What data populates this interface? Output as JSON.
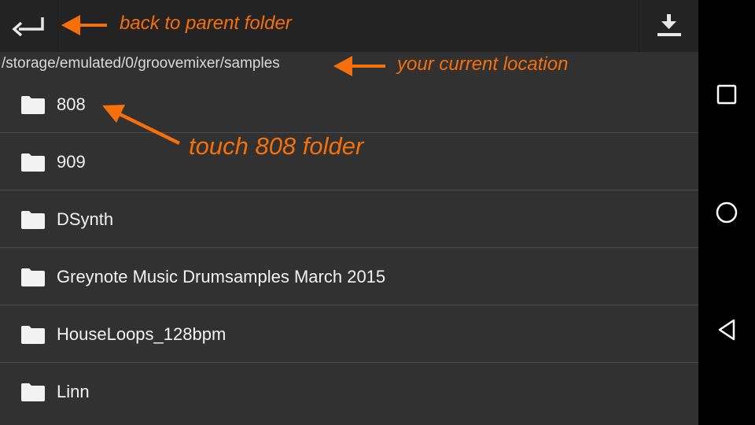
{
  "toolbar": {
    "back_icon": "return-arrow-icon",
    "download_icon": "download-icon"
  },
  "location": {
    "path": "/storage/emulated/0/groovemixer/samples"
  },
  "folders": [
    {
      "label": "808",
      "icon": "folder-icon"
    },
    {
      "label": "909",
      "icon": "folder-icon"
    },
    {
      "label": "DSynth",
      "icon": "folder-icon"
    },
    {
      "label": "Greynote Music Drumsamples March 2015",
      "icon": "folder-icon"
    },
    {
      "label": "HouseLoops_128bpm",
      "icon": "folder-icon"
    },
    {
      "label": "Linn",
      "icon": "folder-icon"
    }
  ],
  "annotations": {
    "back": "back to parent folder",
    "location": "your current location",
    "touch": "touch 808 folder",
    "color": "#f56f0b"
  },
  "nav_bar": {
    "recents_icon": "square-icon",
    "home_icon": "circle-icon",
    "back_icon": "triangle-back-icon"
  }
}
